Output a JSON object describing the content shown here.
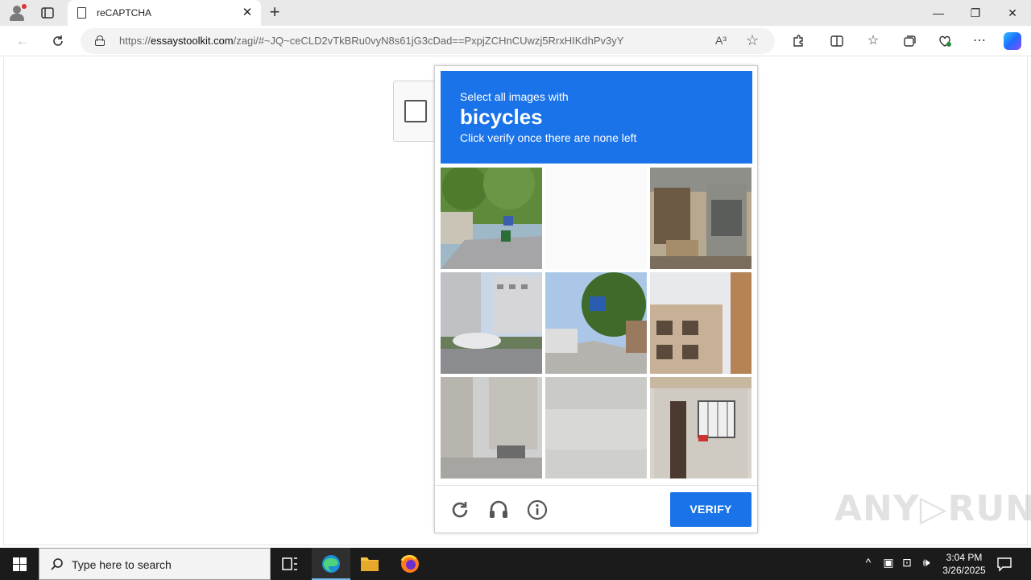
{
  "browser": {
    "tab_title": "reCAPTCHA",
    "tab_close": "✕",
    "new_tab": "+",
    "url_prefix": "https://",
    "url_host": "essaystoolkit.com",
    "url_path": "/zagi/#~JQ~ceCLD2vTkBRu0vyN8s61jG3cDad==PxpjZCHnCUwzj5RrxHIKdhPv3yY",
    "read_aloud": "A³",
    "minimize": "—",
    "restore": "❐",
    "close": "✕"
  },
  "captcha": {
    "prompt_line1": "Select all images with",
    "target": "bicycles",
    "prompt_line3": "Click verify once there are none left",
    "verify_label": "VERIFY",
    "tiles": [
      "street-trees-scooter",
      "blank-loading",
      "street-vendor-cart",
      "city-buildings-car",
      "street-sign-trees",
      "apartment-building",
      "faded-street",
      "faded-blank",
      "doorway-grille"
    ]
  },
  "watermark": "ANY▷RUN",
  "taskbar": {
    "search_placeholder": "Type here to search",
    "time": "3:04 PM",
    "date": "3/26/2025"
  },
  "colors": {
    "captcha_blue": "#1a73e8",
    "taskbar": "#1b1b1b"
  }
}
